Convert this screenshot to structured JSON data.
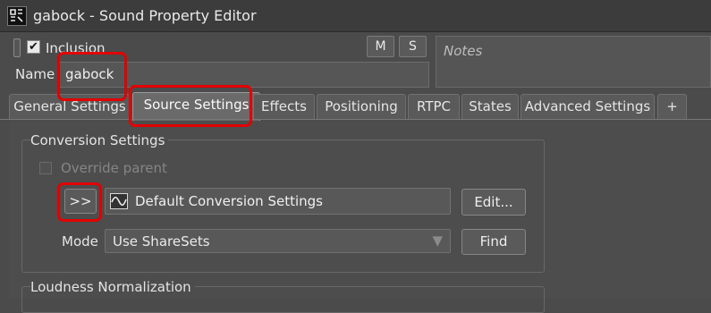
{
  "window": {
    "title": "gabock - Sound Property Editor",
    "app_icon": "wwise-sound-icon"
  },
  "header": {
    "inclusion_label": "Inclusion",
    "inclusion_checked": true,
    "mute_label": "M",
    "solo_label": "S",
    "name_label": "Name",
    "name_value": "gabock",
    "notes_placeholder": "Notes"
  },
  "tabs": [
    {
      "label": "General Settings"
    },
    {
      "label": "Source Settings",
      "active": true
    },
    {
      "label": "Effects"
    },
    {
      "label": "Positioning"
    },
    {
      "label": "RTPC"
    },
    {
      "label": "States"
    },
    {
      "label": "Advanced Settings"
    },
    {
      "label": "+"
    }
  ],
  "conversion_settings": {
    "group_title": "Conversion Settings",
    "override_parent_label": "Override parent",
    "override_parent_checked": false,
    "expand_button_label": ">>",
    "shareset_value": "Default Conversion Settings",
    "edit_button_label": "Edit...",
    "mode_label": "Mode",
    "mode_value": "Use ShareSets",
    "find_button_label": "Find"
  },
  "loudness": {
    "group_title": "Loudness Normalization"
  },
  "highlight_color": "#e20000"
}
